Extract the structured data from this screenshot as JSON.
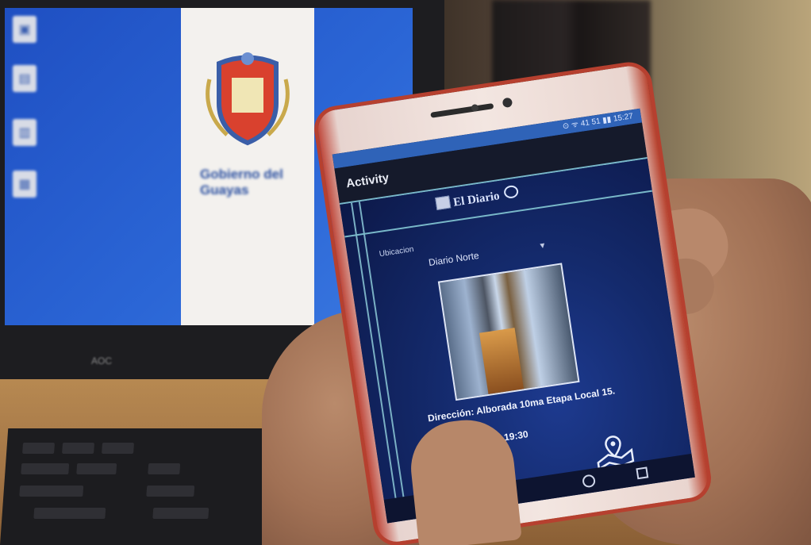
{
  "monitor": {
    "wallpaper_text": "Gobierno del Guayas",
    "brand": "AOC"
  },
  "phone": {
    "status_text": "⊙ ᯤ 41 51 ▮▮ 15:27",
    "app_title": "Activity",
    "brand_name": "El Diario",
    "location_label": "Ubicacion",
    "location_value": "Diario Norte",
    "address": "Dirección: Alborada 10ma Etapa Local 15.",
    "schedule": "Horario: 08:00 - 19:30"
  },
  "colors": {
    "statusbar": "#2f63b8",
    "appbar": "#151a2b",
    "accent_line": "#79b8c9",
    "content_bg": "#142a6c",
    "phone_case": "#b6402f"
  },
  "icons": [
    "wifi-icon",
    "battery-icon",
    "newspaper-logo-icon",
    "chat-bubble-icon",
    "dropdown-caret-icon",
    "map-pin-icon",
    "home-nav-icon",
    "recents-nav-icon"
  ]
}
